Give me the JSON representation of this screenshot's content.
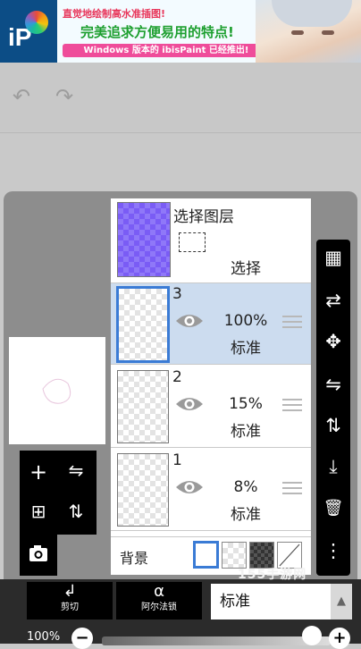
{
  "ad": {
    "logo_text": "iP",
    "line1": "直觉地绘制高水准插图!",
    "line2": "完美追求方便易用的特点!",
    "bar": "Windows 版本的 ibisPaint 已经推出!"
  },
  "toolbar": {
    "undo_icon": "↶",
    "redo_icon": "↷"
  },
  "selection_layer": {
    "title": "选择图层",
    "label": "选择"
  },
  "layers": [
    {
      "num": "3",
      "opacity": "100%",
      "blend": "标准",
      "selected": true
    },
    {
      "num": "2",
      "opacity": "15%",
      "blend": "标准",
      "selected": false
    },
    {
      "num": "1",
      "opacity": "8%",
      "blend": "标准",
      "selected": false
    }
  ],
  "background": {
    "label": "背景",
    "swatches": [
      "white",
      "transparent",
      "dark-checker",
      "none"
    ]
  },
  "left_tools": {
    "add": "+",
    "add_image": "⊞",
    "camera": "📷",
    "flip_h": "⇋",
    "flip_v": "⇅"
  },
  "right_tools": {
    "checker": "▦",
    "swap": "⇄",
    "move": "✥",
    "flip_h": "⇋",
    "flip_v": "⇅",
    "merge_down": "⤓",
    "delete": "🗑",
    "more": "⋮"
  },
  "bottom": {
    "clip_label": "剪切",
    "clip_icon": "↲",
    "alpha_label": "阿尔法锁",
    "alpha_icon": "α",
    "blend_mode": "标准",
    "blend_arrow": "▲"
  },
  "opacity": {
    "label": "100%",
    "minus": "−",
    "plus": "+",
    "value": 1.0
  },
  "watermark": "155手游网",
  "colors": {
    "selected_row": "#ccdcef",
    "selected_border": "#3a7bd5",
    "selection_thumb": "#7a5cf5"
  }
}
